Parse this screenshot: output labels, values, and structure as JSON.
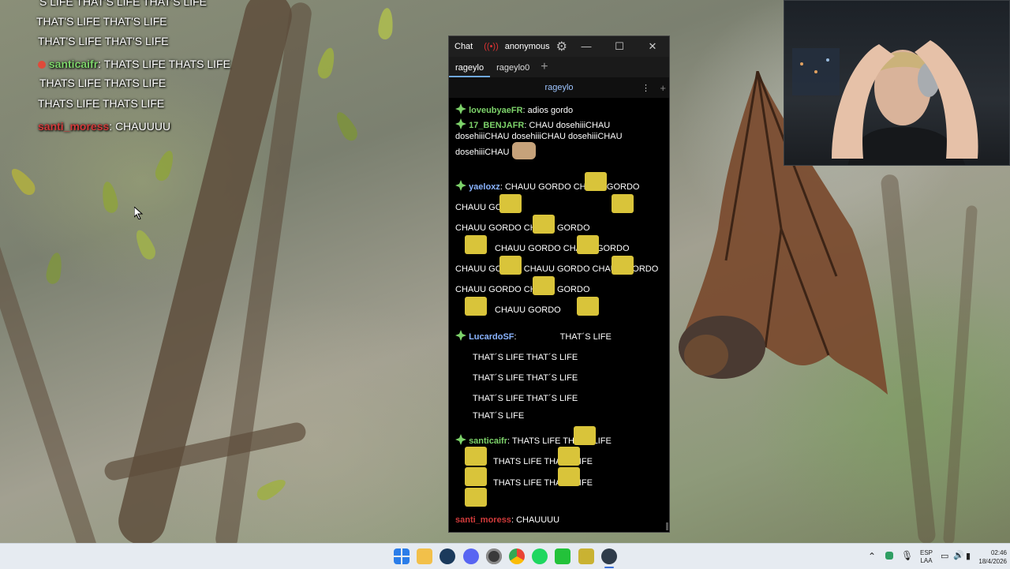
{
  "overlay_chat": {
    "lines": [
      {
        "text": "S LIFE        THAT'S LIFE        THAT'S LIFE"
      },
      {
        "text": "        THAT'S LIFE        THAT'S LIFE"
      },
      {
        "text": "THAT'S LIFE        THAT'S LIFE"
      },
      {
        "user": "santicaifr",
        "text": "THATS LIFE        THATS LIFE"
      },
      {
        "text": "        THATS LIFE        THATS LIFE"
      },
      {
        "text": "THATS LIFE        THATS LIFE"
      },
      {
        "user": "santi_moress",
        "text": "CHAUUUU"
      }
    ]
  },
  "chat_window": {
    "title": "Chat",
    "user": "anonymous",
    "tabs": [
      {
        "label": "rageylo"
      },
      {
        "label": "rageylo0"
      }
    ],
    "channel": "rageylo",
    "messages": [
      {
        "user": "loveubyaeFR",
        "text": "adios gordo"
      },
      {
        "user": "17_BENJAFR",
        "text": "CHAU dosehiiiCHAU dosehiiiCHAU dosehiiiCHAU dosehiiiCHAU dosehiiiCHAU"
      },
      {
        "user": "yaeloxz",
        "text": "CHAUU GORDO        CHAUU GORDO        CHAUU GORDO"
      },
      {
        "text": "CHAUU GORDO        CHAUU GORDO"
      },
      {
        "text": "CHAUU GORDO        CHAUU GORDO"
      },
      {
        "text": "CHAUU GORDO        CHAUU GORDO        CHAUU GORDO"
      },
      {
        "text": "CHAUU GORDO        CHAUU GORDO"
      },
      {
        "text": "CHAUU GORDO"
      },
      {
        "user": "LucardoSF",
        "text": "THAT´S LIFE"
      },
      {
        "text": "THAT´S LIFE        THAT´S LIFE"
      },
      {
        "text": "THAT´S LIFE        THAT´S LIFE"
      },
      {
        "text": "THAT´S LIFE        THAT´S LIFE"
      },
      {
        "text": "THAT´S LIFE"
      },
      {
        "user": "santicaifr",
        "text": "THATS LIFE        THATS LIFE"
      },
      {
        "text": "THATS LIFE        THATS LIFE"
      },
      {
        "text": "THATS LIFE        THATS LIFE"
      },
      {
        "user": "santi_moress",
        "text": "CHAUUUU"
      }
    ]
  },
  "tray": {
    "lang_top": "ESP",
    "lang_bottom": "LAA",
    "time": "02:46",
    "date": "18/4/2026"
  },
  "colors": {
    "user_green": "#7dd36a",
    "user_blue": "#8ab4ff",
    "user_red": "#d23b3b",
    "taskbar": "#e6ebf1"
  }
}
